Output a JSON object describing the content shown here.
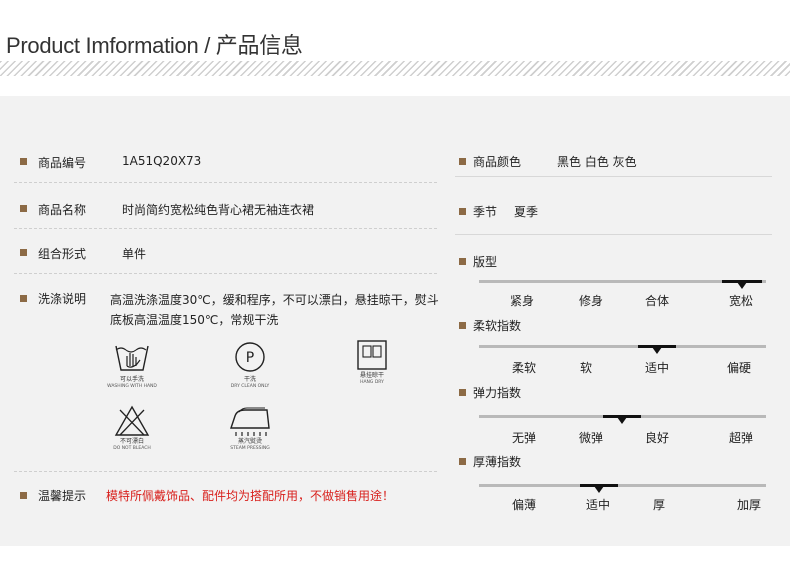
{
  "header": {
    "title": "Product Imformation / 产品信息"
  },
  "left": {
    "sku_label": "商品编号",
    "sku_value": "1A51Q20X73",
    "name_label": "商品名称",
    "name_value": "时尚简约宽松纯色背心裙无袖连衣裙",
    "combo_label": "组合形式",
    "combo_value": "单件",
    "wash_label": "洗涤说明",
    "wash_value": "高温洗涤温度30℃，缓和程序，不可以漂白，悬挂晾干，熨斗底板高温温度150℃，常规干洗",
    "icons": [
      {
        "name": "hand-wash-icon",
        "cn": "可以手洗",
        "en": "WASHING WITH HAND"
      },
      {
        "name": "dry-clean-icon",
        "cn": "干洗",
        "en": "DRY CLEAN ONLY"
      },
      {
        "name": "hang-dry-icon",
        "cn": "悬挂晾干",
        "en": "HANG DRY"
      },
      {
        "name": "no-bleach-icon",
        "cn": "不可漂白",
        "en": "DO NOT BLEACH"
      },
      {
        "name": "steam-press-icon",
        "cn": "蒸汽熨烫",
        "en": "STEAM PRESSING"
      }
    ],
    "dry_clean_letter": "P",
    "tip_label": "温馨提示",
    "tip_value": "模特所佩戴饰品、配件均为搭配所用，不做销售用途！"
  },
  "right": {
    "color_label": "商品颜色",
    "color_value": "黑色 白色 灰色",
    "season_label": "季节",
    "season_value": "夏季",
    "scales": [
      {
        "label": "版型",
        "options": [
          "紧身",
          "修身",
          "合体",
          "宽松"
        ],
        "selected": 3
      },
      {
        "label": "柔软指数",
        "options": [
          "柔软",
          "软",
          "适中",
          "偏硬"
        ],
        "selected": 2
      },
      {
        "label": "弹力指数",
        "options": [
          "无弹",
          "微弹",
          "良好",
          "超弹"
        ],
        "selected": 2
      },
      {
        "label": "厚薄指数",
        "options": [
          "偏薄",
          "适中",
          "厚",
          "加厚"
        ],
        "selected": 1
      }
    ]
  },
  "colors": {
    "bullet": "#8c6a45",
    "tip_red": "#d8201c",
    "panel_bg": "#f2f2f2"
  }
}
